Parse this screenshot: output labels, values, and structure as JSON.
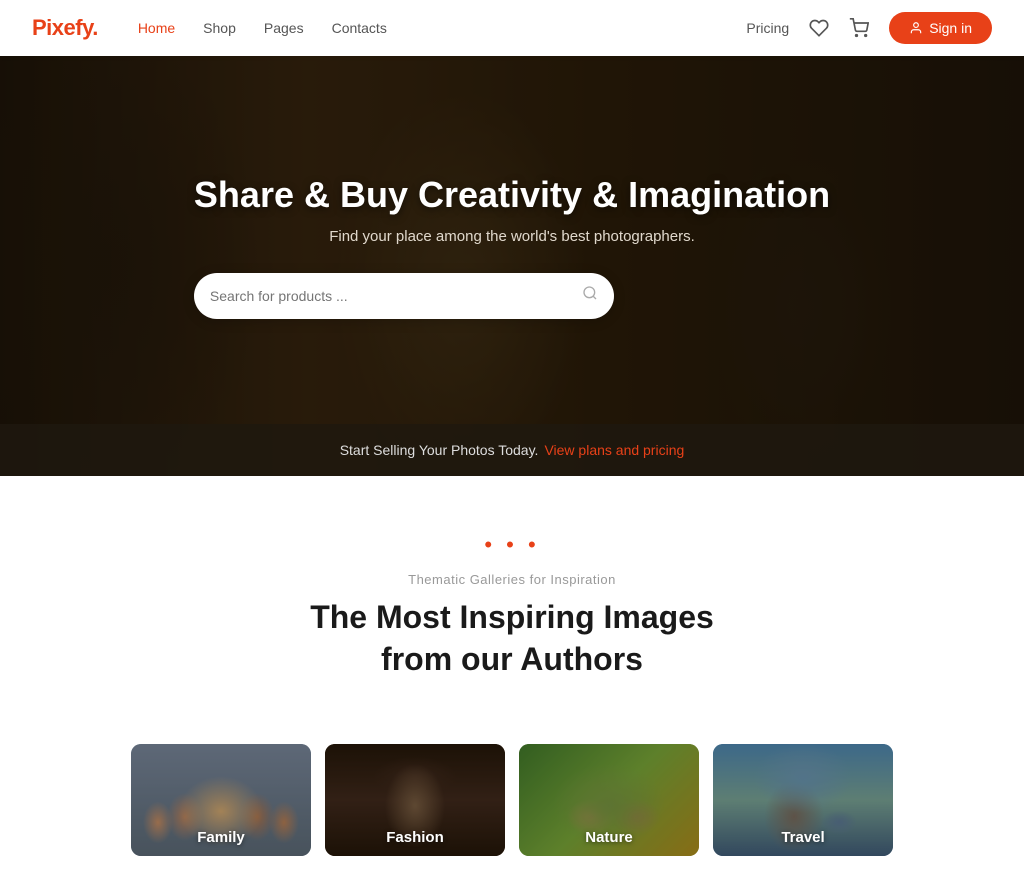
{
  "header": {
    "logo_text": "Pixefy",
    "logo_dot": ".",
    "nav": [
      {
        "label": "Home",
        "active": true
      },
      {
        "label": "Shop",
        "active": false
      },
      {
        "label": "Pages",
        "active": false
      },
      {
        "label": "Contacts",
        "active": false
      }
    ],
    "pricing_label": "Pricing",
    "sign_in_label": "Sign in"
  },
  "hero": {
    "title": "Share & Buy Creativity & Imagination",
    "subtitle": "Find your place among the world's best photographers.",
    "search_placeholder": "Search for products ...",
    "bottom_text": "Start Selling Your Photos Today.",
    "bottom_link": "View plans and pricing"
  },
  "gallery_section": {
    "dots": "• • •",
    "subtitle": "Thematic Galleries for Inspiration",
    "title_line1": "The Most Inspiring Images",
    "title_line2": "from our Authors",
    "cards": [
      {
        "label": "Family",
        "class": "card-family"
      },
      {
        "label": "Fashion",
        "class": "card-fashion"
      },
      {
        "label": "Nature",
        "class": "card-nature"
      },
      {
        "label": "Travel",
        "class": "card-travel"
      }
    ]
  }
}
